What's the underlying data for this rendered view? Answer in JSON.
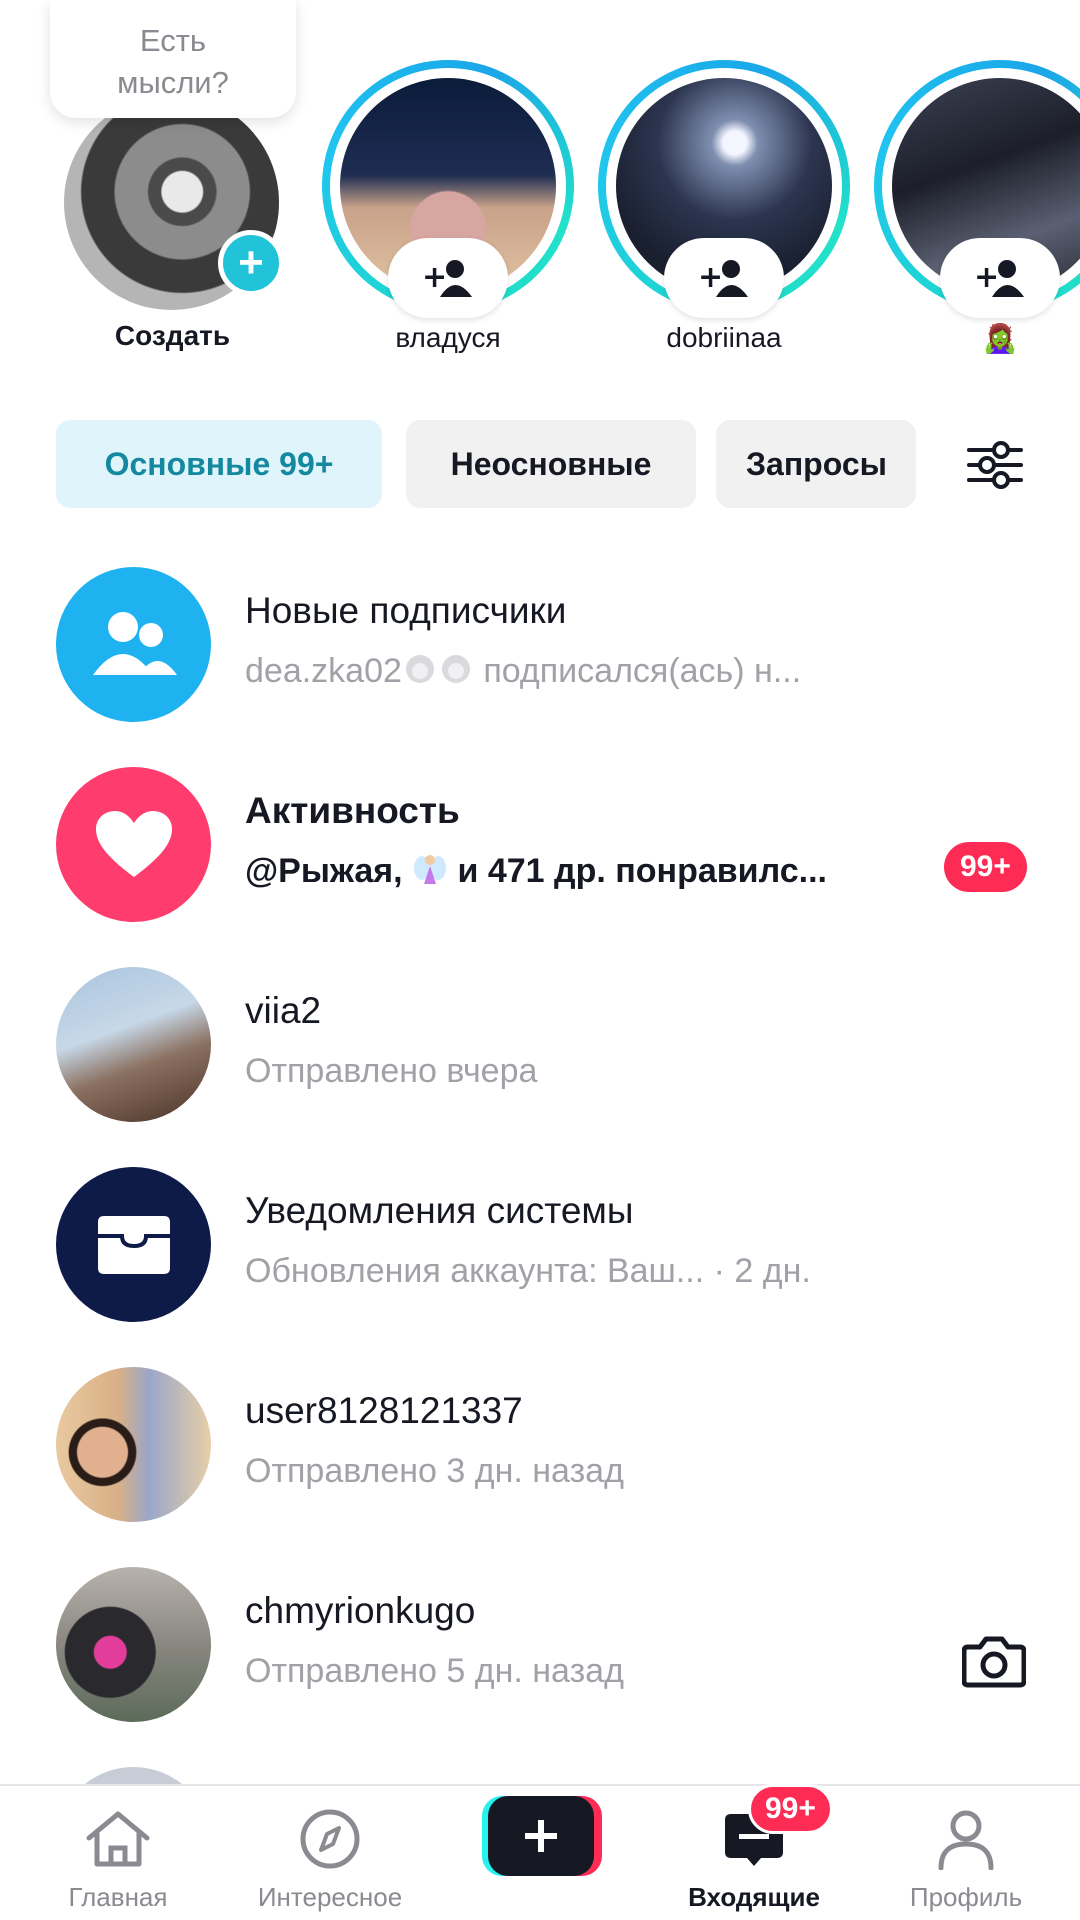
{
  "stories": {
    "thought_prompt": "Есть мысли?",
    "create_label": "Создать",
    "items": [
      {
        "name": "владуся"
      },
      {
        "name": "dobriinaa"
      },
      {
        "name": "🧟‍♀️"
      }
    ]
  },
  "tabs": [
    {
      "label": "Основные 99+",
      "active": true
    },
    {
      "label": "Неосновные",
      "active": false
    },
    {
      "label": "Запросы",
      "active": false
    }
  ],
  "inbox": [
    {
      "title": "Новые подписчики",
      "subtitle_user": "dea.zka02",
      "subtitle_rest": " подписался(ась) н...",
      "avatar_icon": "followers-icon",
      "color": "#1fb2f0"
    },
    {
      "title": "Активность",
      "subtitle_prefix": "@Рыжая, ",
      "subtitle_rest": " и 471 др. понравилс...",
      "badge": "99+",
      "avatar_icon": "heart-icon",
      "color": "#fe3d6e"
    },
    {
      "title": "viia2",
      "subtitle": "Отправлено вчера"
    },
    {
      "title": "Уведомления системы",
      "subtitle": "Обновления аккаунта: Ваш...",
      "time": " · 2 дн.",
      "avatar_icon": "inbox-tray-icon",
      "color": "#0e1a48"
    },
    {
      "title": "user8128121337",
      "subtitle": "Отправлено 3 дн. назад"
    },
    {
      "title": "chmyrionkugo",
      "subtitle": "Отправлено 5 дн. назад",
      "action_icon": "camera-icon"
    }
  ],
  "nav": {
    "home": "Главная",
    "discover": "Интересное",
    "inbox": "Входящие",
    "profile": "Профиль",
    "inbox_badge": "99+"
  }
}
